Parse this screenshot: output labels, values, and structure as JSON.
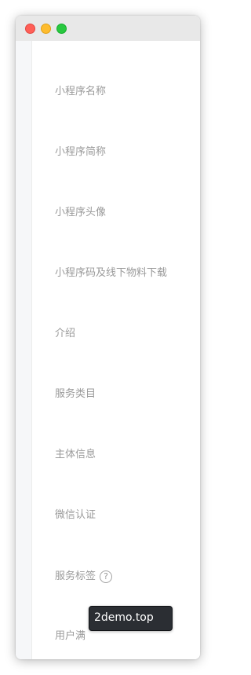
{
  "window": {
    "controls": [
      "close",
      "minimize",
      "zoom"
    ]
  },
  "settings": {
    "items": [
      {
        "label": "小程序名称"
      },
      {
        "label": "小程序简称"
      },
      {
        "label": "小程序头像"
      },
      {
        "label": "小程序码及线下物料下载"
      },
      {
        "label": "介绍"
      },
      {
        "label": "服务类目"
      },
      {
        "label": "主体信息"
      },
      {
        "label": "微信认证"
      },
      {
        "label": "服务标签",
        "help_icon": "?"
      },
      {
        "label": "用户满"
      }
    ]
  },
  "tooltip": {
    "text": "2demo.top"
  },
  "colors": {
    "titlebar": "#e8e8e8",
    "label_text": "#9a9a9a",
    "tooltip_bg": "#2b2e33"
  }
}
